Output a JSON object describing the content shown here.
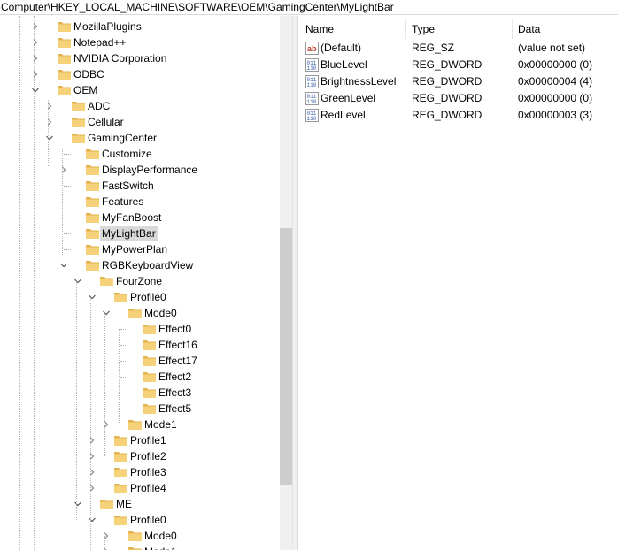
{
  "address_bar": {
    "path": "Computer\\HKEY_LOCAL_MACHINE\\SOFTWARE\\OEM\\GamingCenter\\MyLightBar"
  },
  "tree": {
    "nodes": [
      {
        "label": "MozillaPlugins",
        "chevron": "right"
      },
      {
        "label": "Notepad++",
        "chevron": "right"
      },
      {
        "label": "NVIDIA Corporation",
        "chevron": "right"
      },
      {
        "label": "ODBC",
        "chevron": "right"
      },
      {
        "label": "OEM",
        "chevron": "down"
      },
      {
        "label": "ADC",
        "chevron": "right"
      },
      {
        "label": "Cellular",
        "chevron": "right"
      },
      {
        "label": "GamingCenter",
        "chevron": "down"
      },
      {
        "label": "Customize",
        "chevron": "none"
      },
      {
        "label": "DisplayPerformance",
        "chevron": "right"
      },
      {
        "label": "FastSwitch",
        "chevron": "none"
      },
      {
        "label": "Features",
        "chevron": "none"
      },
      {
        "label": "MyFanBoost",
        "chevron": "none"
      },
      {
        "label": "MyLightBar",
        "chevron": "none",
        "selected": true
      },
      {
        "label": "MyPowerPlan",
        "chevron": "none"
      },
      {
        "label": "RGBKeyboardView",
        "chevron": "down"
      },
      {
        "label": "FourZone",
        "chevron": "down"
      },
      {
        "label": "Profile0",
        "chevron": "down"
      },
      {
        "label": "Mode0",
        "chevron": "down"
      },
      {
        "label": "Effect0",
        "chevron": "none"
      },
      {
        "label": "Effect16",
        "chevron": "none"
      },
      {
        "label": "Effect17",
        "chevron": "none"
      },
      {
        "label": "Effect2",
        "chevron": "none"
      },
      {
        "label": "Effect3",
        "chevron": "none"
      },
      {
        "label": "Effect5",
        "chevron": "none"
      },
      {
        "label": "Mode1",
        "chevron": "right"
      },
      {
        "label": "Profile1",
        "chevron": "right"
      },
      {
        "label": "Profile2",
        "chevron": "right"
      },
      {
        "label": "Profile3",
        "chevron": "right"
      },
      {
        "label": "Profile4",
        "chevron": "right"
      },
      {
        "label": "ME",
        "chevron": "down"
      },
      {
        "label": "Profile0",
        "chevron": "down"
      },
      {
        "label": "Mode0",
        "chevron": "right"
      },
      {
        "label": "Mode1",
        "chevron": "right"
      }
    ]
  },
  "values_pane": {
    "columns": {
      "name": "Name",
      "type": "Type",
      "data": "Data"
    },
    "rows": [
      {
        "icon": "string-value-icon",
        "name": "(Default)",
        "type": "REG_SZ",
        "data": "(value not set)"
      },
      {
        "icon": "dword-value-icon",
        "name": "BlueLevel",
        "type": "REG_DWORD",
        "data": "0x00000000 (0)"
      },
      {
        "icon": "dword-value-icon",
        "name": "BrightnessLevel",
        "type": "REG_DWORD",
        "data": "0x00000004 (4)"
      },
      {
        "icon": "dword-value-icon",
        "name": "GreenLevel",
        "type": "REG_DWORD",
        "data": "0x00000000 (0)"
      },
      {
        "icon": "dword-value-icon",
        "name": "RedLevel",
        "type": "REG_DWORD",
        "data": "0x00000003 (3)"
      }
    ]
  },
  "colors": {
    "folder": "#f5d17a",
    "folder_dark": "#e2b44f",
    "selection": "#d9d9d9",
    "dword_icon": "#3a5fa8",
    "string_icon": "#c0392b"
  }
}
